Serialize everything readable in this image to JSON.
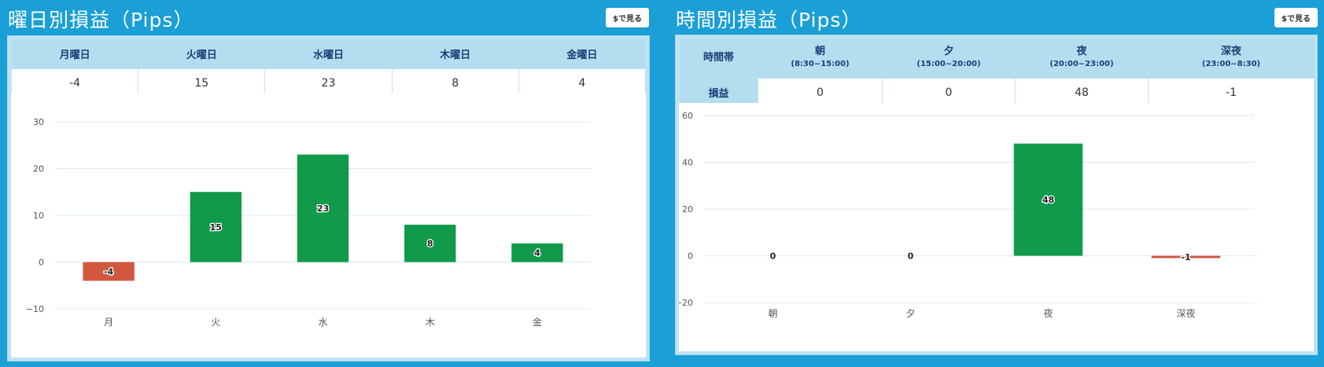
{
  "day_panel": {
    "title": "曜日別損益（Pips）",
    "usd_button": "$で見る",
    "headers": [
      "月曜日",
      "火曜日",
      "水曜日",
      "木曜日",
      "金曜日"
    ],
    "values": [
      "-4",
      "15",
      "23",
      "8",
      "4"
    ]
  },
  "time_panel": {
    "title": "時間別損益（Pips）",
    "usd_button": "$で見る",
    "row_header_label": "時間帯",
    "row_value_label": "損益",
    "headers": [
      {
        "label": "朝",
        "range": "(8:30~15:00)"
      },
      {
        "label": "夕",
        "range": "(15:00~20:00)"
      },
      {
        "label": "夜",
        "range": "(20:00~23:00)"
      },
      {
        "label": "深夜",
        "range": "(23:00~8:30)"
      }
    ],
    "values": [
      "0",
      "0",
      "48",
      "-1"
    ]
  },
  "colors": {
    "positive": "#109a4a",
    "negative": "#d2573f",
    "background": "#1a9fd6"
  },
  "chart_data": [
    {
      "type": "bar",
      "categories": [
        "月",
        "火",
        "水",
        "木",
        "金"
      ],
      "values": [
        -4,
        15,
        23,
        8,
        4
      ],
      "title": "",
      "xlabel": "",
      "ylabel": "",
      "ylim": [
        -10,
        30
      ],
      "yticks": [
        -10,
        0,
        10,
        20,
        30
      ],
      "grid": true
    },
    {
      "type": "bar",
      "categories": [
        "朝",
        "夕",
        "夜",
        "深夜"
      ],
      "values": [
        0,
        0,
        48,
        -1
      ],
      "title": "",
      "xlabel": "",
      "ylabel": "",
      "ylim": [
        -20,
        60
      ],
      "yticks": [
        -20,
        0,
        20,
        40,
        60
      ],
      "grid": true
    }
  ]
}
